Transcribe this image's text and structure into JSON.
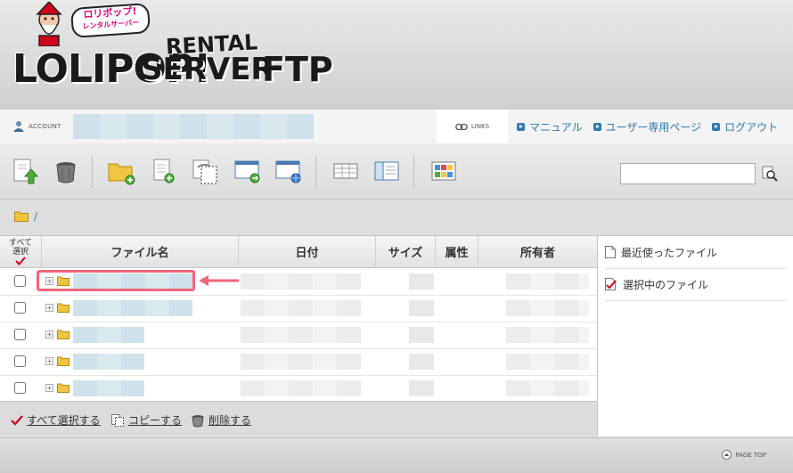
{
  "header": {
    "logo_badge_line1": "ロリポップ!",
    "logo_badge_line2": "レンタルサーバー",
    "logo_main": "LOLIPOP!",
    "logo_rental": "RENTAL",
    "logo_server": "SERVER",
    "logo_ftp": "FTP"
  },
  "account_bar": {
    "account_label": "ACCOUNT",
    "links_label": "LINKS",
    "nav_links": [
      {
        "label": "マニュアル"
      },
      {
        "label": "ユーザー専用ページ"
      },
      {
        "label": "ログアウト"
      }
    ]
  },
  "toolbar": {
    "buttons": [
      "upload-icon",
      "trash-icon",
      "new-folder-icon",
      "new-file-icon",
      "copy-icon",
      "move-icon",
      "web-view-icon",
      "list-view-icon",
      "detail-view-icon",
      "thumbnail-view-icon"
    ],
    "search_value": ""
  },
  "path": {
    "root": "/"
  },
  "table": {
    "headers": {
      "select_all_line1": "すべて",
      "select_all_line2": "選択",
      "name": "ファイル名",
      "date": "日付",
      "size": "サイズ",
      "attr": "属性",
      "owner": "所有者"
    }
  },
  "bulk": {
    "select_all": "すべて選択する",
    "copy": "コピーする",
    "delete": "削除する"
  },
  "side": {
    "recent": "最近使ったファイル",
    "selected": "選択中のファイル"
  },
  "footer": {
    "page_top": "PAGE TOP"
  },
  "colors": {
    "link": "#2e7bb2",
    "highlight": "#f2657a",
    "accent_check": "#d0021b"
  }
}
